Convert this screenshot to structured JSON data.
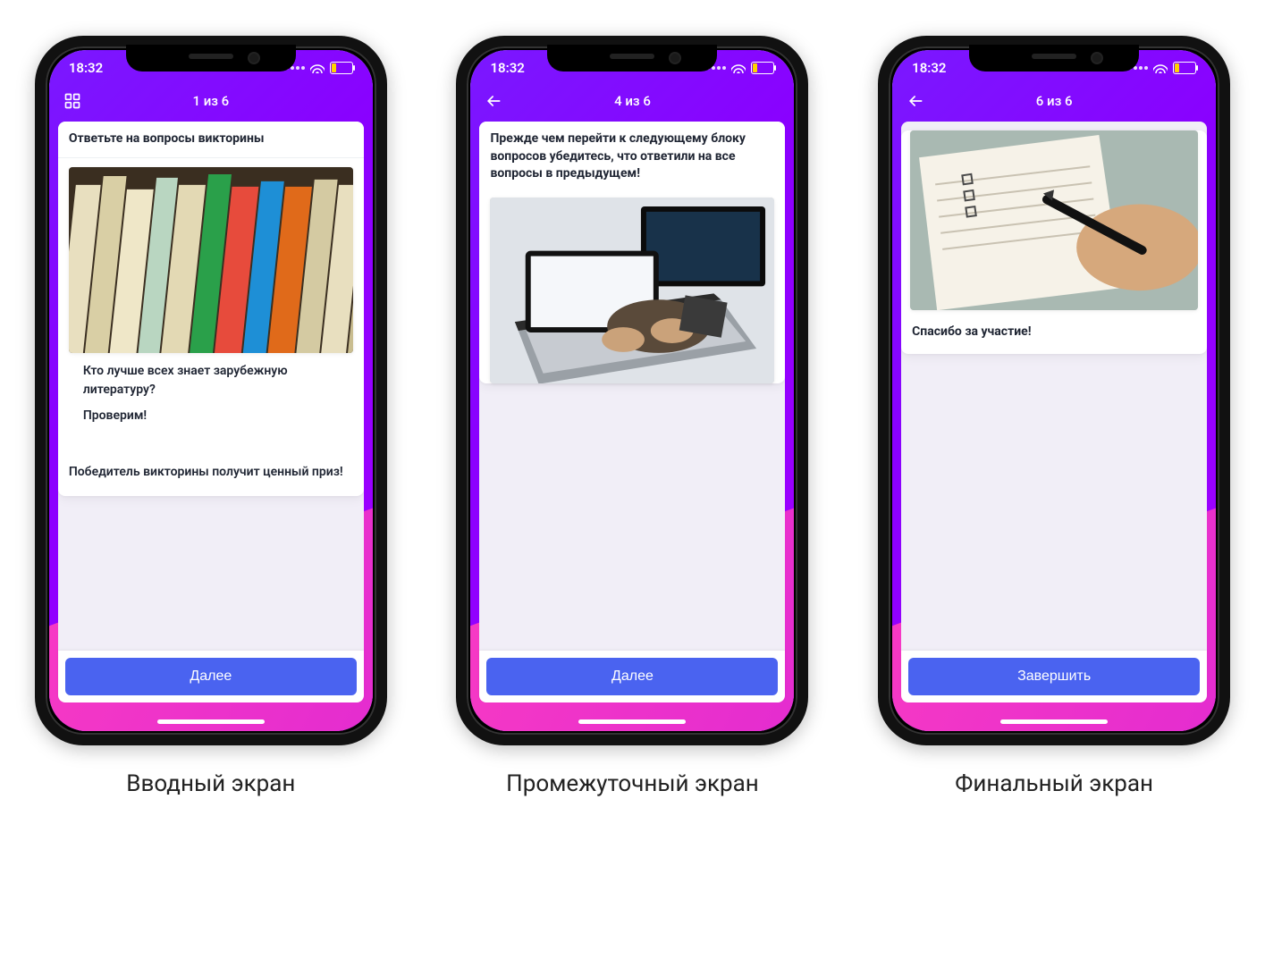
{
  "status": {
    "time": "18:32"
  },
  "colors": {
    "accent": "#4a63f0",
    "grad_a": "#7a18ff",
    "grad_b": "#e22bd1"
  },
  "screens": [
    {
      "icon": "grid",
      "progress": "1 из 6",
      "title": "Ответьте на вопросы викторины",
      "body_line1": "Кто лучше всех знает зарубежную литературу?",
      "body_line2": "Проверим!",
      "body_line3": "Победитель викторины получит ценный приз!",
      "cta": "Далее",
      "caption": "Вводный экран"
    },
    {
      "icon": "back",
      "progress": "4 из 6",
      "title": "Прежде чем перейти к следующему блоку вопросов убедитесь, что ответили на все вопросы в предыдущем!",
      "cta": "Далее",
      "caption": "Промежуточный экран"
    },
    {
      "icon": "back",
      "progress": "6 из 6",
      "thanks": "Спасибо за участие!",
      "cta": "Завершить",
      "caption": "Финальный экран"
    }
  ]
}
